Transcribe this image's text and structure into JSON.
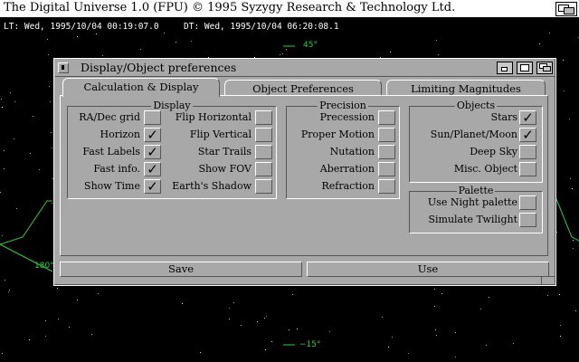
{
  "screen_title": "The Digital Universe 1.0 (FPU) © 1995 Syzygy Research & Technology Ltd.",
  "status": {
    "lt": "LT: Wed, 1995/10/04 00:19:07.0",
    "dt": "DT: Wed, 1995/10/04 06:20:08.1"
  },
  "sky_labels": {
    "top": "45°",
    "left": "180°",
    "bottom": "−15°"
  },
  "dialog": {
    "title": "Display/Object preferences",
    "tabs": [
      "Calculation & Display",
      "Object Preferences",
      "Limiting Magnitudes"
    ],
    "active_tab": 0,
    "groups": {
      "display": {
        "title": "Display",
        "left_items": [
          {
            "label": "RA/Dec grid",
            "checked": false,
            "mark": ""
          },
          {
            "label": "Horizon",
            "checked": true,
            "mark": "✓"
          },
          {
            "label": "Fast Labels",
            "checked": true,
            "mark": "✓"
          },
          {
            "label": "Fast info.",
            "checked": true,
            "mark": "✓"
          },
          {
            "label": "Show Time",
            "checked": true,
            "mark": "✓"
          }
        ],
        "right_items": [
          {
            "label": "Flip Horizontal",
            "checked": false,
            "mark": ""
          },
          {
            "label": "Flip Vertical",
            "checked": false,
            "mark": ""
          },
          {
            "label": "Star Trails",
            "checked": false,
            "mark": ""
          },
          {
            "label": "Show FOV",
            "checked": false,
            "mark": ""
          },
          {
            "label": "Earth's Shadow",
            "checked": false,
            "mark": ""
          }
        ]
      },
      "precision": {
        "title": "Precision",
        "items": [
          {
            "label": "Precession",
            "checked": false,
            "mark": ""
          },
          {
            "label": "Proper Motion",
            "checked": false,
            "mark": ""
          },
          {
            "label": "Nutation",
            "checked": false,
            "mark": ""
          },
          {
            "label": "Aberration",
            "checked": false,
            "mark": ""
          },
          {
            "label": "Refraction",
            "checked": false,
            "mark": ""
          }
        ]
      },
      "objects": {
        "title": "Objects",
        "items": [
          {
            "label": "Stars",
            "checked": true,
            "mark": "✓"
          },
          {
            "label": "Sun/Planet/Moon",
            "checked": true,
            "mark": "✓"
          },
          {
            "label": "Deep Sky",
            "checked": false,
            "mark": ""
          },
          {
            "label": "Misc. Object",
            "checked": false,
            "mark": ""
          }
        ]
      },
      "palette": {
        "title": "Palette",
        "items": [
          {
            "label": "Use Night palette",
            "checked": false,
            "mark": ""
          },
          {
            "label": "Simulate Twilight",
            "checked": false,
            "mark": ""
          }
        ]
      }
    },
    "buttons": {
      "save": "Save",
      "use": "Use"
    }
  },
  "colors": {
    "window_bg": "#a8a8a8",
    "sky": "#000000",
    "grid_lines": "#33cc33",
    "status_text": "#ffffff"
  }
}
